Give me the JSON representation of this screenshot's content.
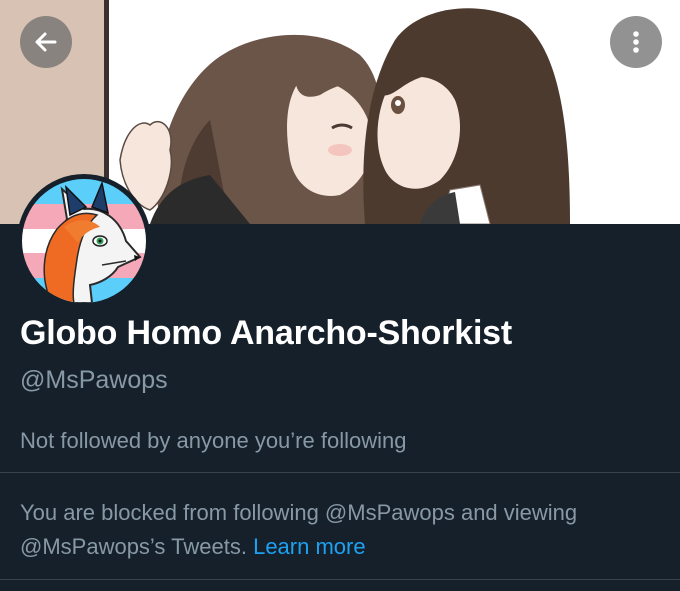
{
  "profile": {
    "display_name": "Globo Homo Anarcho-Shorkist",
    "handle": "@MsPawops",
    "follow_context": "Not followed by anyone you’re following"
  },
  "blocked_notice": {
    "text": "You are blocked from following @MsPawops and viewing @MsPawops’s Tweets.",
    "link_label": "Learn more"
  },
  "icons": {
    "back": "arrow-left-icon",
    "more": "more-vertical-icon"
  },
  "colors": {
    "background": "#15202b",
    "primary_text": "#ffffff",
    "secondary_text": "#8899a6",
    "link": "#1da1f2",
    "divider": "#38444d"
  }
}
